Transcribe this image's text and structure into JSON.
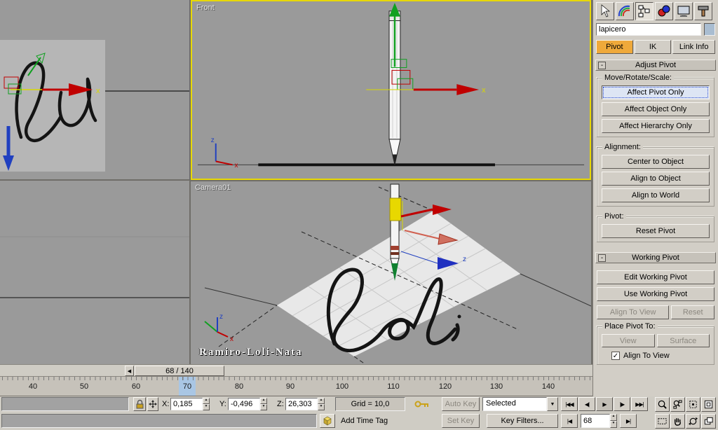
{
  "viewports": {
    "front_label": "Front",
    "camera_label": "Camera01",
    "watermark": "Ramiro-Loli-Nata"
  },
  "panel": {
    "object_name": "lapicero",
    "tabs": {
      "pivot": "Pivot",
      "ik": "IK",
      "link_info": "Link Info"
    },
    "adjust_pivot": {
      "title": "Adjust Pivot",
      "collapse": "-",
      "group_mrs": "Move/Rotate/Scale:",
      "affect_pivot_only": "Affect Pivot Only",
      "affect_object_only": "Affect Object Only",
      "affect_hierarchy_only": "Affect Hierarchy Only",
      "group_alignment": "Alignment:",
      "center_to_object": "Center to Object",
      "align_to_object": "Align to Object",
      "align_to_world": "Align to World",
      "group_pivot": "Pivot:",
      "reset_pivot": "Reset Pivot"
    },
    "working_pivot": {
      "title": "Working Pivot",
      "collapse": "-",
      "edit_working_pivot": "Edit Working Pivot",
      "use_working_pivot": "Use Working Pivot",
      "align_to_view": "Align To View",
      "reset": "Reset",
      "group_place": "Place Pivot To:",
      "view": "View",
      "surface": "Surface",
      "align_to_view_checkbox": "Align To View",
      "check_glyph": "✓"
    }
  },
  "timeline": {
    "slider_label": "68 / 140",
    "slider_left_arrow": "◀",
    "ticks": [
      "40",
      "50",
      "60",
      "70",
      "80",
      "90",
      "100",
      "110",
      "120",
      "130",
      "140"
    ]
  },
  "status": {
    "x_label": "X:",
    "x_value": "0,185",
    "y_label": "Y:",
    "y_value": "-0,496",
    "z_label": "Z:",
    "z_value": "26,303",
    "grid_label": "Grid = 10,0",
    "auto_key": "Auto Key",
    "set_key": "Set Key",
    "selection_set": "Selected",
    "key_filters": "Key Filters...",
    "add_time_tag": "Add Time Tag",
    "frame_value": "68",
    "dropdown_glyph": "▼",
    "spin_up": "▲",
    "spin_down": "▼",
    "playback": {
      "go_start": "|◀◀",
      "prev": "◀|",
      "play": "▶",
      "next": "|▶",
      "go_end": "▶▶|",
      "prev_key": "|◀",
      "next_key": "▶|"
    }
  }
}
